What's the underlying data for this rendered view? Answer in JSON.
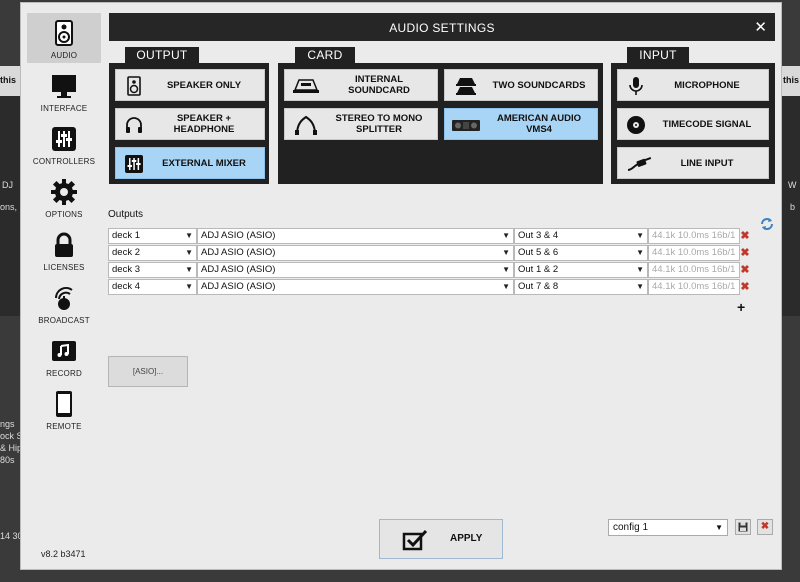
{
  "background": {
    "left_texts": [
      "this",
      "DJ",
      "ons,",
      "ngs",
      "ock S",
      "& Hip",
      "80s",
      "14 30"
    ],
    "right_texts": [
      "this",
      "W",
      "b"
    ]
  },
  "window": {
    "title": "AUDIO SETTINGS",
    "close_icon": "close-icon"
  },
  "sidebar": {
    "items": [
      {
        "label": "AUDIO",
        "icon": "speaker-icon",
        "active": true
      },
      {
        "label": "INTERFACE",
        "icon": "monitor-icon"
      },
      {
        "label": "CONTROLLERS",
        "icon": "sliders-icon"
      },
      {
        "label": "OPTIONS",
        "icon": "gear-icon"
      },
      {
        "label": "LICENSES",
        "icon": "lock-icon"
      },
      {
        "label": "BROADCAST",
        "icon": "broadcast-icon"
      },
      {
        "label": "RECORD",
        "icon": "record-icon"
      },
      {
        "label": "REMOTE",
        "icon": "tablet-icon"
      }
    ],
    "version": "v8.2 b3471"
  },
  "output": {
    "heading": "OUTPUT",
    "options": [
      {
        "label": "SPEAKER ONLY",
        "icon": "speaker-icon"
      },
      {
        "label": "SPEAKER + HEADPHONE",
        "icon": "headphone-icon"
      },
      {
        "label": "EXTERNAL MIXER",
        "icon": "mixer-icon",
        "selected": true
      }
    ]
  },
  "card": {
    "heading": "CARD",
    "options": [
      {
        "label": "INTERNAL SOUNDCARD",
        "icon": "soundcard-icon"
      },
      {
        "label": "TWO SOUNDCARDS",
        "icon": "two-soundcards-icon"
      },
      {
        "label": "STEREO TO MONO SPLITTER",
        "icon": "splitter-cable-icon"
      },
      {
        "label": "AMERICAN AUDIO VMS4",
        "icon": "controller-device-icon",
        "selected": true
      }
    ]
  },
  "input": {
    "heading": "INPUT",
    "options": [
      {
        "label": "MICROPHONE",
        "icon": "microphone-icon"
      },
      {
        "label": "TIMECODE SIGNAL",
        "icon": "vinyl-icon"
      },
      {
        "label": "LINE INPUT",
        "icon": "cable-plug-icon"
      }
    ]
  },
  "outputs": {
    "label": "Outputs",
    "rows": [
      {
        "deck": "deck 1",
        "device": "ADJ ASIO (ASIO)",
        "channels": "Out 3 & 4",
        "format": "44.1k 10.0ms 16b/1"
      },
      {
        "deck": "deck 2",
        "device": "ADJ ASIO (ASIO)",
        "channels": "Out 5 & 6",
        "format": "44.1k 10.0ms 16b/1"
      },
      {
        "deck": "deck 3",
        "device": "ADJ ASIO (ASIO)",
        "channels": "Out 1 & 2",
        "format": "44.1k 10.0ms 16b/1"
      },
      {
        "deck": "deck 4",
        "device": "ADJ ASIO (ASIO)",
        "channels": "Out 7 & 8",
        "format": "44.1k 10.0ms 16b/1"
      }
    ],
    "delete_icon": "delete-icon",
    "add_symbol": "+",
    "refresh_icon": "refresh-icon"
  },
  "asio_button": "[ASIO]...",
  "apply": {
    "label": "APPLY",
    "icon": "checkbox-icon"
  },
  "config": {
    "value": "config 1",
    "save_icon": "save-icon",
    "delete_icon": "delete-icon"
  },
  "colors": {
    "selected": "#a8d4f5",
    "panel": "#212121",
    "titlebar": "#262626",
    "delete": "#c0392b"
  }
}
